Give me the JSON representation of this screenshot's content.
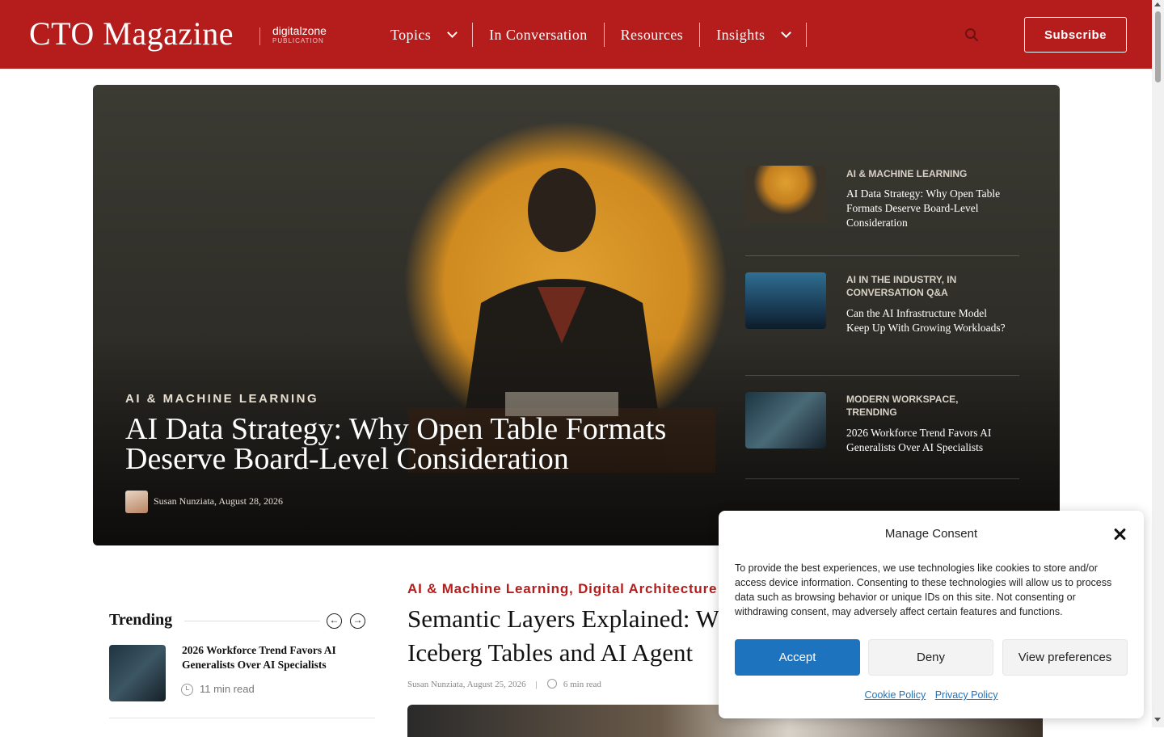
{
  "header": {
    "logo": "CTO Magazine",
    "publisher_name": "digitalzone",
    "publisher_tag": "PUBLICATION",
    "nav": [
      {
        "label": "Topics",
        "has_dropdown": true
      },
      {
        "label": "In Conversation",
        "has_dropdown": false
      },
      {
        "label": "Resources",
        "has_dropdown": false
      },
      {
        "label": "Insights",
        "has_dropdown": true
      }
    ],
    "search_icon": "search-icon",
    "subscribe_label": "Subscribe",
    "brand_color": "#b51c1c"
  },
  "hero": {
    "category": "AI & MACHINE LEARNING",
    "title": "AI Data Strategy: Why Open Table Formats Deserve Board-Level Consideration",
    "byline": "Susan Nunziata, August 28, 2026",
    "side_items": [
      {
        "category": "AI & MACHINE LEARNING",
        "title": "AI Data Strategy: Why Open Table Formats Deserve Board-Level Consideration"
      },
      {
        "category": "AI IN THE INDUSTRY, IN CONVERSATION Q&A",
        "title": "Can the AI Infrastructure Model Keep Up With Growing Workloads?"
      },
      {
        "category": "MODERN WORKSPACE, TRENDING",
        "title": "2026 Workforce Trend Favors AI Generalists Over AI Specialists"
      }
    ]
  },
  "trending": {
    "heading": "Trending",
    "items": [
      {
        "title": "2026 Workforce Trend Favors AI Generalists Over AI Specialists",
        "read_time": "11 min read"
      }
    ]
  },
  "article": {
    "categories": "AI & Machine Learning, Digital Architecture",
    "title_line1": "Semantic Layers Explained: W",
    "title_line2": "Iceberg Tables and AI Agent",
    "author_date": "Susan Nunziata, August 25, 2026",
    "separator": "|",
    "read_time": "6 min read"
  },
  "consent": {
    "title": "Manage Consent",
    "body": "To provide the best experiences, we use technologies like cookies to store and/or access device information. Consenting to these technologies will allow us to process data such as browsing behavior or unique IDs on this site. Not consenting or withdrawing consent, may adversely affect certain features and functions.",
    "accept_label": "Accept",
    "deny_label": "Deny",
    "preferences_label": "View preferences",
    "cookie_policy_label": "Cookie Policy",
    "privacy_policy_label": "Privacy Policy",
    "accent_color": "#1e73be"
  }
}
